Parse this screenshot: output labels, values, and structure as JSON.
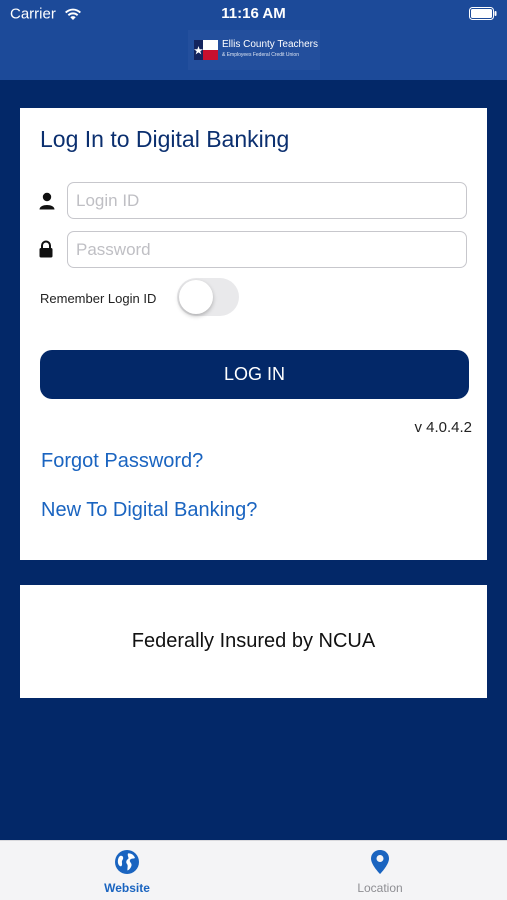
{
  "status_bar": {
    "carrier": "Carrier",
    "time": "11:16 AM"
  },
  "logo": {
    "name": "Ellis County Teachers",
    "subtitle": "& Employees Federal Credit Union"
  },
  "login": {
    "title": "Log In to Digital Banking",
    "login_id_placeholder": "Login ID",
    "password_placeholder": "Password",
    "remember_label": "Remember Login ID",
    "remember_enabled": false,
    "login_button": "LOG IN",
    "version": "v 4.0.4.2",
    "forgot_password": "Forgot Password?",
    "new_user": "New To Digital Banking?"
  },
  "ncua": {
    "text": "Federally Insured by NCUA"
  },
  "tab_bar": {
    "tabs": [
      {
        "label": "Website",
        "icon": "globe-icon",
        "active": true
      },
      {
        "label": "Location",
        "icon": "location-pin-icon",
        "active": false
      }
    ]
  },
  "colors": {
    "navy": "#032868",
    "header_blue": "#1c4a99",
    "link_blue": "#1a64c0",
    "title_navy": "#0b2f6f"
  }
}
